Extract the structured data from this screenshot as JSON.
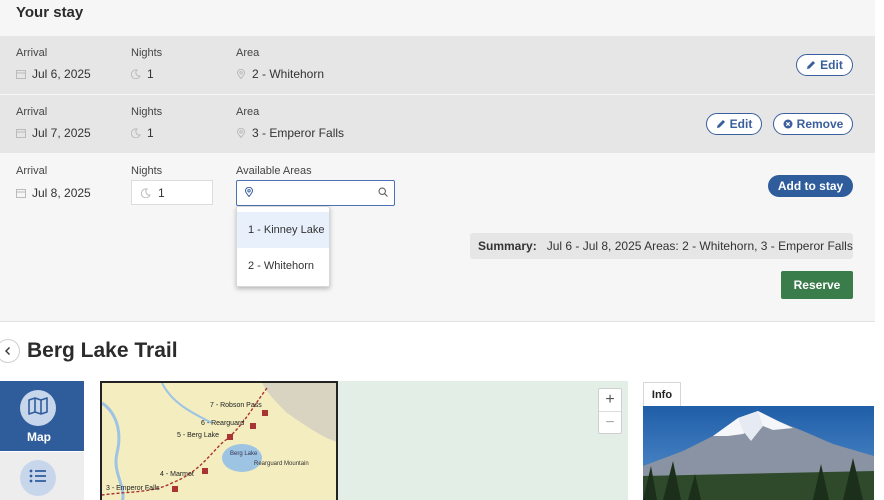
{
  "stay": {
    "title": "Your stay",
    "rows": [
      {
        "arrival_label": "Arrival",
        "arrival": "Jul 6, 2025",
        "nights_label": "Nights",
        "nights": "1",
        "area_label": "Area",
        "area": "2 - Whitehorn",
        "edit_label": "Edit"
      },
      {
        "arrival_label": "Arrival",
        "arrival": "Jul 7, 2025",
        "nights_label": "Nights",
        "nights": "1",
        "area_label": "Area",
        "area": "3 - Emperor Falls",
        "edit_label": "Edit",
        "remove_label": "Remove"
      }
    ],
    "new_row": {
      "arrival_label": "Arrival",
      "arrival": "Jul 8, 2025",
      "nights_label": "Nights",
      "nights": "1",
      "areas_label": "Available Areas",
      "area_value": "",
      "add_label": "Add to stay"
    },
    "dropdown": [
      "1 - Kinney Lake",
      "2 - Whitehorn"
    ],
    "summary": {
      "label": "Summary:",
      "text": "Jul 6 - Jul 8, 2025 Areas: 2 - Whitehorn, 3 - Emperor Falls"
    },
    "reserve_label": "Reserve"
  },
  "trail": {
    "title": "Berg Lake Trail",
    "nav": {
      "map_label": "Map"
    },
    "map_labels": [
      "7 - Robson Pass",
      "6 - Rearguard",
      "5 - Berg Lake",
      "4 - Marmot",
      "3 - Emperor Falls",
      "Berg Lake",
      "Rearguard Mountain"
    ],
    "zoom_in": "+",
    "zoom_out": "−",
    "info_label": "Info"
  },
  "colors": {
    "primary": "#2f5d9b",
    "reserve": "#3a7c4a",
    "row_grey": "#e6e6e6"
  },
  "icons": [
    "calendar-icon",
    "moon-icon",
    "map-pin-icon",
    "pencil-icon",
    "x-circle-icon",
    "search-icon",
    "chevron-left-icon",
    "map-icon",
    "list-icon"
  ]
}
